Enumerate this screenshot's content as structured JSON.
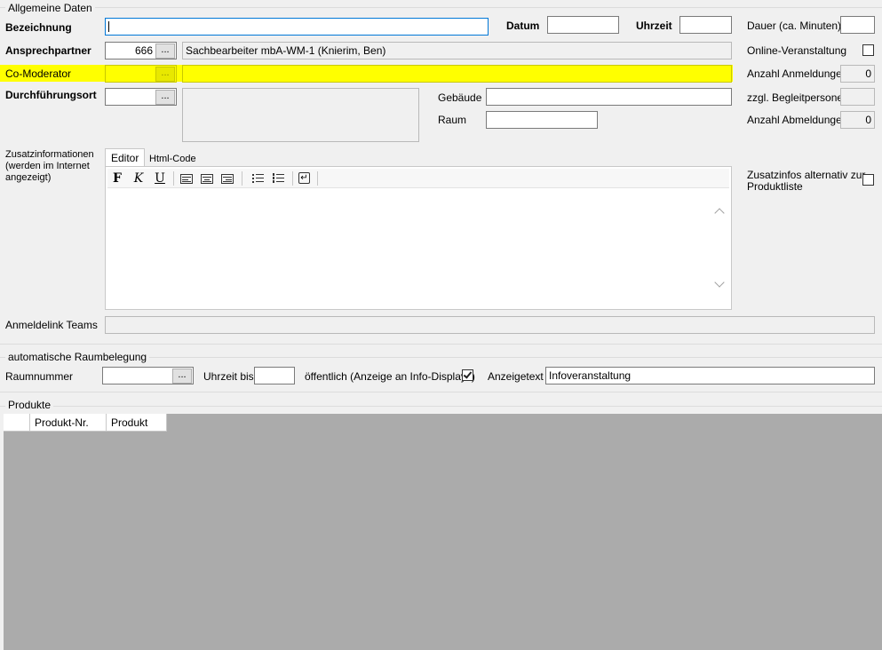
{
  "groups": {
    "general": "Allgemeine Daten",
    "room": "automatische Raumbelegung",
    "products": "Produkte"
  },
  "general": {
    "bezeichnung_label": "Bezeichnung",
    "bezeichnung_value": "",
    "datum_label": "Datum",
    "datum_value": "",
    "uhrzeit_label": "Uhrzeit",
    "uhrzeit_value": "",
    "dauer_label": "Dauer (ca. Minuten)",
    "dauer_value": "",
    "ansprechpartner_label": "Ansprechpartner",
    "ansprechpartner_id": "666",
    "ansprechpartner_name": "Sachbearbeiter mbA-WM-1 (Knierim, Ben)",
    "online_label": "Online-Veranstaltung",
    "online_checked": false,
    "comoderator_label": "Co-Moderator",
    "comoderator_id": "",
    "comoderator_name": "",
    "highlight_color": "#ffff00",
    "anmeldungen_label": "Anzahl Anmeldungen",
    "anmeldungen_value": "0",
    "ort_label": "Durchführungsort",
    "ort_id": "",
    "gebaeude_label": "Gebäude",
    "gebaeude_value": "",
    "begleit_label": "zzgl. Begleitpersonen",
    "begleit_value": "",
    "raum_label": "Raum",
    "raum_value": "",
    "abmeldungen_label": "Anzahl Abmeldungen",
    "abmeldungen_value": "0",
    "zusatz_label_1": "Zusatzinformationen",
    "zusatz_label_2": "(werden im Internet",
    "zusatz_label_3": "angezeigt)",
    "tab_editor": "Editor",
    "tab_html": "Html-Code",
    "tb_bold": "F",
    "tb_italic": "K",
    "tb_underline": "U",
    "zusatz_alt_label_1": "Zusatzinfos alternativ zur",
    "zusatz_alt_label_2": "Produktliste",
    "zusatz_alt_checked": false,
    "teams_label": "Anmeldelink Teams",
    "teams_value": "",
    "ellipsis": "..."
  },
  "room": {
    "raumnummer_label": "Raumnummer",
    "raumnummer_value": "",
    "uhrzeit_bis_label": "Uhrzeit bis",
    "uhrzeit_bis_value": "",
    "oeffentlich_label": "öffentlich (Anzeige an Info-Displays)",
    "oeffentlich_checked": true,
    "anzeigetext_label": "Anzeigetext",
    "anzeigetext_value": "Infoveranstaltung"
  },
  "products": {
    "columns": [
      "Produkt-Nr.",
      "Produkt"
    ]
  }
}
